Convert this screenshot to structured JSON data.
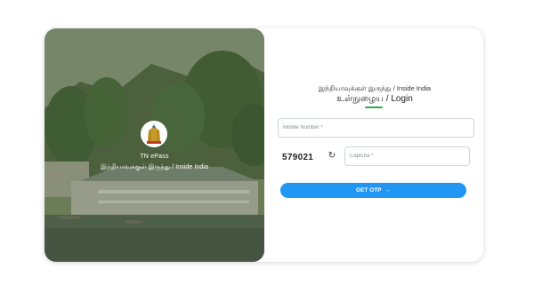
{
  "brand": {
    "name": "TN ePass",
    "subtitle": "இந்தியாவுக்குள் இருந்து / Inside India"
  },
  "login": {
    "heading": "இந்தியாவுக்குள் இருந்து / Inside India",
    "title": "உள்நுழைய / Login",
    "mobile_placeholder": "Mobile Number *",
    "captcha_code": "579021",
    "captcha_placeholder": "Captcha *",
    "submit_label": "GET OTP",
    "submit_arrow": "→",
    "refresh_glyph": "↻"
  },
  "colors": {
    "accent": "#2196f3",
    "underline": "#2fa84f"
  },
  "icons": [
    "tamil-nadu-emblem-icon",
    "refresh-icon",
    "arrow-right-icon"
  ]
}
